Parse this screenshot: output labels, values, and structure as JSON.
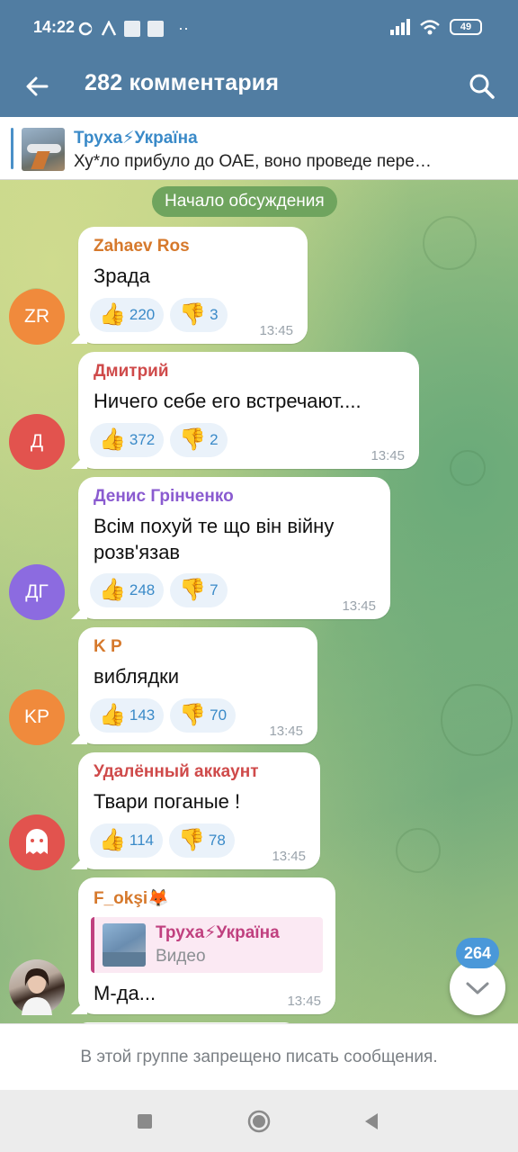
{
  "status_bar": {
    "time": "14:22",
    "battery": "49"
  },
  "header": {
    "title": "282 комментария"
  },
  "pinned": {
    "title": "Труха⚡Україна",
    "text": "Ху*ло прибуло до ОАЕ, воно проведе перe…"
  },
  "date_chip": "Начало обсуждения",
  "messages": [
    {
      "sender": "Zahaev Ros",
      "sender_color": "#d6792c",
      "text": "Зрада",
      "avatar_text": "ZR",
      "avatar_color": "#f08a3c",
      "likes": "220",
      "dislikes": "3",
      "time": "13:45"
    },
    {
      "sender": "Дмитрий",
      "sender_color": "#cf4a4a",
      "text": "Ничего себе его встречают....",
      "avatar_text": "Д",
      "avatar_color": "#e2534e",
      "likes": "372",
      "dislikes": "2",
      "time": "13:45"
    },
    {
      "sender": "Денис Грінченко",
      "sender_color": "#8a5bd0",
      "text_line1": "Всім похуй те що він війну",
      "text_line2": "розв'язав",
      "avatar_text": "ДГ",
      "avatar_color": "#8c6be0",
      "likes": "248",
      "dislikes": "7",
      "time": "13:45"
    },
    {
      "sender": "K P",
      "sender_color": "#d6792c",
      "text": "виблядки",
      "avatar_text": "KP",
      "avatar_color": "#f08a3c",
      "likes": "143",
      "dislikes": "70",
      "time": "13:45"
    },
    {
      "sender": "Удалённый аккаунт",
      "sender_color": "#cf4a4a",
      "text": "Твари поганые !",
      "avatar_color": "#e2534e",
      "likes": "114",
      "dislikes": "78",
      "time": "13:45"
    },
    {
      "sender": "F_okşi🦊",
      "sender_color": "#d6792c",
      "forward_title": "Труха⚡Україна",
      "forward_subtitle": "Видео",
      "text": "М-да...",
      "time": "13:45"
    }
  ],
  "unread_badge": "264",
  "bottom_notice": "В этой группе запрещено писать сообщения.",
  "icons": {
    "back": "arrow-left-icon",
    "search": "search-icon",
    "like": "👍",
    "dislike": "👎",
    "ghost": "ghost-icon",
    "scroll_down": "chevron-down-icon"
  }
}
